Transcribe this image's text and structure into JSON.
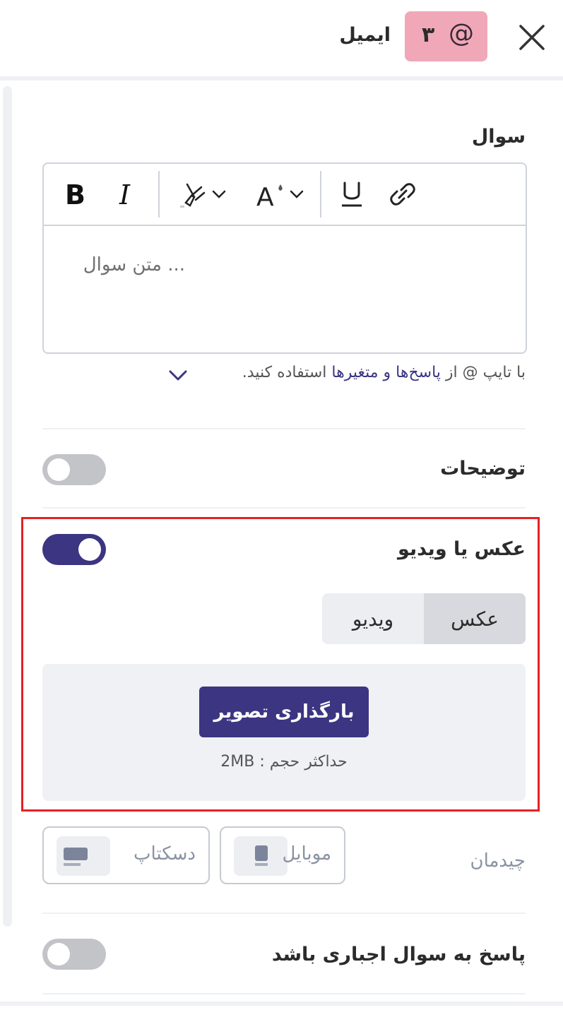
{
  "header": {
    "title": "ایمیل",
    "badge_number": "۳",
    "badge_symbol": "@",
    "badge_color": "#f0a8b9"
  },
  "question": {
    "label": "سوال",
    "placeholder": "... متن سوال",
    "toolbar": [
      "bold",
      "italic",
      "highlight",
      "text-color",
      "underline",
      "link"
    ],
    "hint_prefix": "با تایپ @ از",
    "hint_link": "پاسخ‌ها و متغیرها",
    "hint_suffix": "استفاده کنید."
  },
  "description": {
    "label": "توضیحات",
    "enabled": false
  },
  "media": {
    "label": "عکس یا ویدیو",
    "enabled": true,
    "tabs": [
      "عکس",
      "ویدیو"
    ],
    "selected_tab": "عکس",
    "upload_button": "بارگذاری تصویر",
    "size_note": "حداکثر حجم : 2MB"
  },
  "layout": {
    "label": "چیدمان",
    "options": [
      "موبایل",
      "دسکتاپ"
    ]
  },
  "required": {
    "label": "پاسخ به سوال اجباری باشد",
    "enabled": false
  },
  "colors": {
    "accent": "#3b3582",
    "highlight_box": "#e32227"
  }
}
